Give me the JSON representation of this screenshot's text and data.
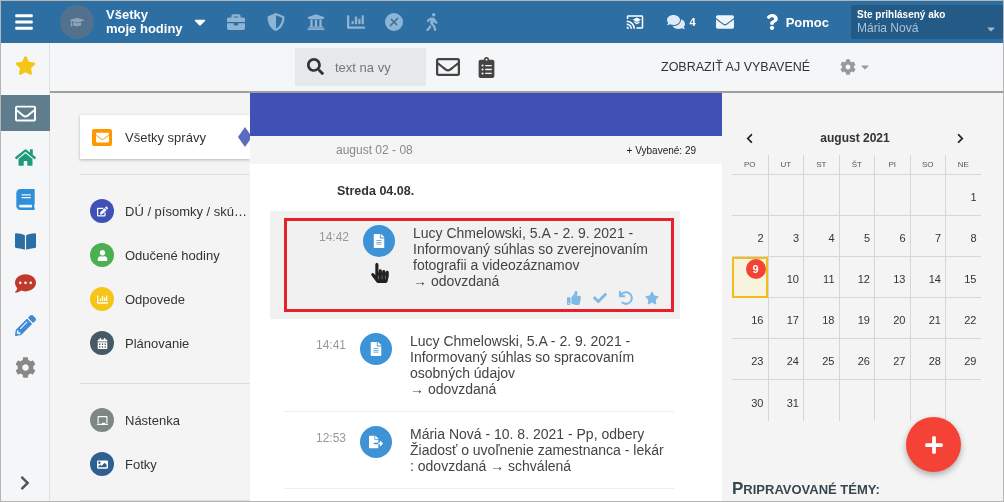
{
  "topbar": {
    "class_selector": {
      "line1": "Všetky",
      "line2": "moje hodiny"
    },
    "messages_count": "4",
    "help": "Pomoc",
    "user": {
      "label": "Ste prihlásený ako",
      "name": "Mária Nová"
    }
  },
  "toolbar": {
    "search_placeholder": "text na vy",
    "show_done": "ZOBRAZIŤ AJ VYBAVENÉ"
  },
  "rail": [
    {
      "kind": "favorites",
      "selected": false
    },
    {
      "kind": "messages",
      "selected": true
    },
    {
      "kind": "home",
      "selected": false
    },
    {
      "kind": "notebook",
      "selected": false
    },
    {
      "kind": "book",
      "selected": false
    },
    {
      "kind": "chat",
      "selected": false
    },
    {
      "kind": "pen",
      "selected": false
    },
    {
      "kind": "settings",
      "selected": false
    }
  ],
  "menu": {
    "active": "Všetky správy",
    "groups": [
      [
        {
          "kind": "homework",
          "label": "DÚ / písomky / skú…",
          "color": "#3f51b5"
        },
        {
          "kind": "lessons",
          "label": "Odučené hodiny",
          "color": "#4caf50"
        },
        {
          "kind": "answers",
          "label": "Odpovede",
          "color": "#f5c518"
        },
        {
          "kind": "planning",
          "label": "Plánovanie",
          "color": "#455a64"
        }
      ],
      [
        {
          "kind": "board",
          "label": "Nástenka",
          "color": "#7d8784"
        },
        {
          "kind": "photos",
          "label": "Fotky",
          "color": "#2f5f8f"
        }
      ]
    ]
  },
  "week": {
    "range": "august 02 - 08",
    "done_count": "+ Vybavené: 29"
  },
  "day_heading": "Streda 04.08.",
  "messages": [
    {
      "time": "14:42",
      "kind": "document",
      "title": "Lucy Chmelowski, 5.A - 2. 9. 2021 - Informovaný súhlas so zverejnovaním fotografii a videozáznamov",
      "status": "→ odovzdaná",
      "selected": true
    },
    {
      "time": "14:41",
      "kind": "document",
      "title": "Lucy Chmelowski, 5.A - 2. 9. 2021 - Informovaný súhlas so spracovaním osobných údajov",
      "status": "→ odovzdaná",
      "selected": false
    },
    {
      "time": "12:53",
      "kind": "request",
      "title": "Mária Nová - 10. 8. 2021 - Pp, odbery Žiadosť o uvoľnenie zamestnanca - lekár : odovzdaná → schválená",
      "selected": false
    }
  ],
  "calendar": {
    "month": "august 2021",
    "weekdays": [
      "PO",
      "UT",
      "ST",
      "ŠT",
      "PI",
      "SO",
      "NE"
    ],
    "weeks": [
      [
        {
          "kind": "empty"
        },
        {
          "kind": "empty"
        },
        {
          "kind": "empty"
        },
        {
          "kind": "empty"
        },
        {
          "kind": "empty"
        },
        {
          "kind": "empty"
        },
        {
          "kind": "day",
          "day": "1",
          "today": false,
          "selected": false
        }
      ],
      [
        {
          "kind": "day",
          "day": "2",
          "today": false,
          "selected": false
        },
        {
          "kind": "day",
          "day": "3",
          "today": false,
          "selected": false
        },
        {
          "kind": "day",
          "day": "4",
          "today": false,
          "selected": false
        },
        {
          "kind": "day",
          "day": "5",
          "today": false,
          "selected": false
        },
        {
          "kind": "day",
          "day": "6",
          "today": false,
          "selected": false
        },
        {
          "kind": "day",
          "day": "7",
          "today": false,
          "selected": false
        },
        {
          "kind": "day",
          "day": "8",
          "today": false,
          "selected": false
        }
      ],
      [
        {
          "kind": "day",
          "day": "9",
          "today": true,
          "selected": true
        },
        {
          "kind": "day",
          "day": "10",
          "today": false,
          "selected": false
        },
        {
          "kind": "day",
          "day": "11",
          "today": false,
          "selected": false
        },
        {
          "kind": "day",
          "day": "12",
          "today": false,
          "selected": false
        },
        {
          "kind": "day",
          "day": "13",
          "today": false,
          "selected": false
        },
        {
          "kind": "day",
          "day": "14",
          "today": false,
          "selected": false
        },
        {
          "kind": "day",
          "day": "15",
          "today": false,
          "selected": false
        }
      ],
      [
        {
          "kind": "day",
          "day": "16",
          "today": false,
          "selected": false
        },
        {
          "kind": "day",
          "day": "17",
          "today": false,
          "selected": false
        },
        {
          "kind": "day",
          "day": "18",
          "today": false,
          "selected": false
        },
        {
          "kind": "day",
          "day": "19",
          "today": false,
          "selected": false
        },
        {
          "kind": "day",
          "day": "20",
          "today": false,
          "selected": false
        },
        {
          "kind": "day",
          "day": "21",
          "today": false,
          "selected": false
        },
        {
          "kind": "day",
          "day": "22",
          "today": false,
          "selected": false
        }
      ],
      [
        {
          "kind": "day",
          "day": "23",
          "today": false,
          "selected": false
        },
        {
          "kind": "day",
          "day": "24",
          "today": false,
          "selected": false
        },
        {
          "kind": "day",
          "day": "25",
          "today": false,
          "selected": false
        },
        {
          "kind": "day",
          "day": "26",
          "today": false,
          "selected": false
        },
        {
          "kind": "day",
          "day": "27",
          "today": false,
          "selected": false
        },
        {
          "kind": "day",
          "day": "28",
          "today": false,
          "selected": false
        },
        {
          "kind": "day",
          "day": "29",
          "today": false,
          "selected": false
        }
      ],
      [
        {
          "kind": "day",
          "day": "30",
          "today": false,
          "selected": false
        },
        {
          "kind": "day",
          "day": "31",
          "today": false,
          "selected": false
        },
        {
          "kind": "empty"
        },
        {
          "kind": "empty"
        },
        {
          "kind": "empty"
        },
        {
          "kind": "empty"
        },
        {
          "kind": "empty"
        }
      ]
    ]
  },
  "topics_heading": "PRIPRAVOVANÉ TÉMY:"
}
